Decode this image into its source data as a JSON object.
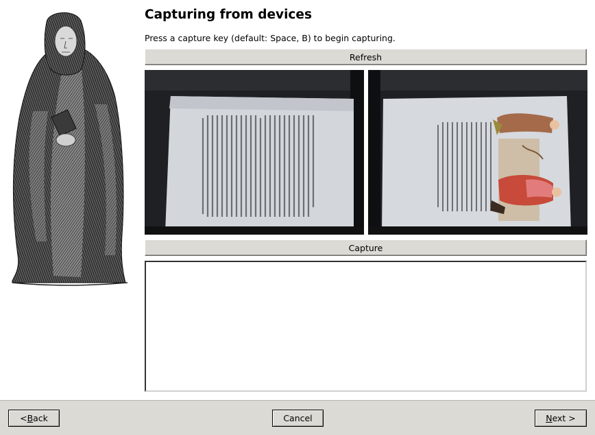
{
  "page": {
    "title": "Capturing from devices",
    "instructions": "Press a capture key (default: Space, B) to begin capturing."
  },
  "buttons": {
    "refresh": "Refresh",
    "capture": "Capture"
  },
  "nav": {
    "back_prefix": "< ",
    "back_mnemonic": "B",
    "back_rest": "ack",
    "cancel": "Cancel",
    "next_mnemonic": "N",
    "next_rest": "ext >"
  },
  "log": {
    "text": ""
  },
  "icons": {
    "illustration": "monk-engraving-illustration",
    "preview_left": "left-page-camera-preview",
    "preview_right": "right-page-camera-preview"
  }
}
